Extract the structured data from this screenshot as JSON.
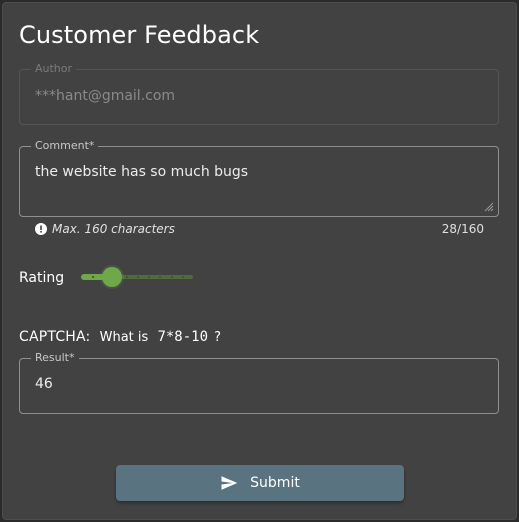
{
  "form": {
    "title": "Customer Feedback",
    "author": {
      "label": "Author",
      "value": "***hant@gmail.com",
      "disabled": true
    },
    "comment": {
      "label": "Comment*",
      "value": "the website has so much bugs",
      "hint": "Max. 160 characters",
      "counter": "28/160"
    },
    "rating": {
      "label": "Rating",
      "value": 2,
      "min": 0,
      "max": 10
    },
    "captcha": {
      "label": "CAPTCHA:",
      "question_prefix": "What is",
      "expression": "7*8-10",
      "question_suffix": "?"
    },
    "result": {
      "label": "Result*",
      "value": "46"
    },
    "submit_label": "Submit"
  },
  "colors": {
    "card_bg": "#424242",
    "accent_green": "#6ea84a",
    "button_bg": "#5a7380"
  },
  "icons": {
    "hint": "info-circle-icon",
    "submit": "send-icon",
    "textarea": "resize-handle-icon"
  }
}
